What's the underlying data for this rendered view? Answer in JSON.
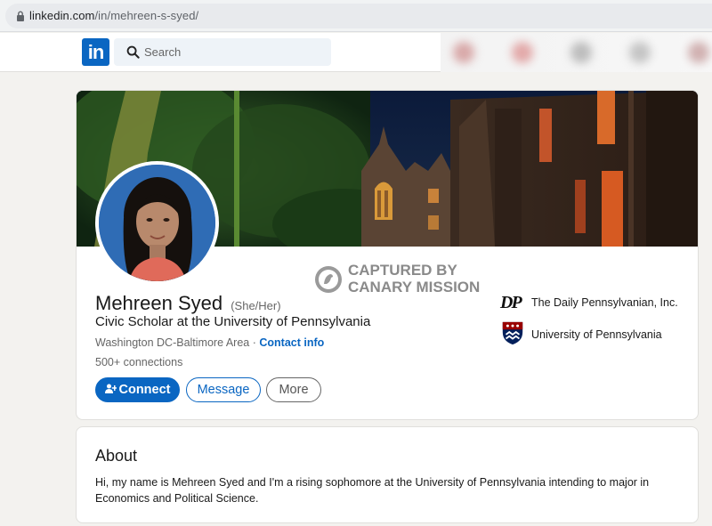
{
  "browser": {
    "url_host": "linkedin.com",
    "url_path": "/in/mehreen-s-syed/"
  },
  "nav": {
    "logo_text": "in",
    "search_placeholder": "Search"
  },
  "profile": {
    "name": "Mehreen Syed",
    "pronouns": "(She/Her)",
    "headline": "Civic Scholar at the University of Pennsylvania",
    "location": "Washington DC-Baltimore Area",
    "location_separator": "·",
    "contact_info_label": "Contact info",
    "connections": "500+ connections",
    "buttons": {
      "connect": "Connect",
      "message": "Message",
      "more": "More"
    },
    "organizations": [
      {
        "logo_text": "DP",
        "name": "The Daily Pennsylvanian, Inc."
      },
      {
        "logo_text": "",
        "name": "University of Pennsylvania"
      }
    ]
  },
  "watermark": {
    "line1": "CAPTURED BY",
    "line2": "CANARY MISSION"
  },
  "about": {
    "title": "About",
    "text": "Hi, my name is Mehreen Syed and I'm a rising sophomore at the University of Pennsylvania intending to major in Economics and Political Science."
  },
  "colors": {
    "linkedin_blue": "#0a66c2",
    "page_bg": "#f3f2ef",
    "penn_red": "#990000",
    "penn_blue": "#011f5b"
  }
}
